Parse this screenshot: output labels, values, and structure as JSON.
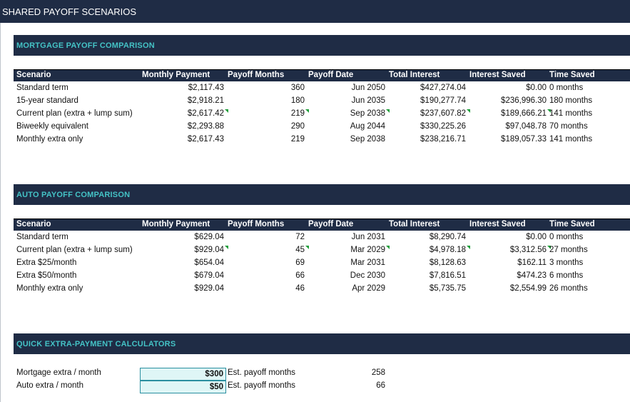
{
  "sheet_title": "SHARED PAYOFF SCENARIOS",
  "columns": [
    "Scenario",
    "Monthly Payment",
    "Payoff Months",
    "Payoff Date",
    "Total Interest",
    "Interest Saved",
    "Time Saved"
  ],
  "mortgage": {
    "section_title": "MORTGAGE PAYOFF COMPARISON",
    "rows": [
      {
        "scenario": "Standard term",
        "payment": "$2,117.43",
        "months": "360",
        "date": "Jun 2050",
        "interest": "$427,274.04",
        "saved": "$0.00",
        "time": "0 months"
      },
      {
        "scenario": "15-year standard",
        "payment": "$2,918.21",
        "months": "180",
        "date": "Jun 2035",
        "interest": "$190,277.74",
        "saved": "$236,996.30",
        "time": "180 months"
      },
      {
        "scenario": "Current plan (extra + lump sum)",
        "payment": "$2,617.42",
        "months": "219",
        "date": "Sep 2038",
        "interest": "$237,607.82",
        "saved": "$189,666.21",
        "time": "141 months"
      },
      {
        "scenario": "Biweekly equivalent",
        "payment": "$2,293.88",
        "months": "290",
        "date": "Aug 2044",
        "interest": "$330,225.26",
        "saved": "$97,048.78",
        "time": "70 months"
      },
      {
        "scenario": "Monthly extra only",
        "payment": "$2,617.43",
        "months": "219",
        "date": "Sep 2038",
        "interest": "$238,216.71",
        "saved": "$189,057.33",
        "time": "141 months"
      }
    ]
  },
  "auto": {
    "section_title": "AUTO PAYOFF COMPARISON",
    "rows": [
      {
        "scenario": "Standard term",
        "payment": "$629.04",
        "months": "72",
        "date": "Jun 2031",
        "interest": "$8,290.74",
        "saved": "$0.00",
        "time": "0 months"
      },
      {
        "scenario": "Current plan (extra + lump sum)",
        "payment": "$929.04",
        "months": "45",
        "date": "Mar 2029",
        "interest": "$4,978.18",
        "saved": "$3,312.56",
        "time": "27 months"
      },
      {
        "scenario": "Extra $25/month",
        "payment": "$654.04",
        "months": "69",
        "date": "Mar 2031",
        "interest": "$8,128.63",
        "saved": "$162.11",
        "time": "3 months"
      },
      {
        "scenario": "Extra $50/month",
        "payment": "$679.04",
        "months": "66",
        "date": "Dec 2030",
        "interest": "$7,816.51",
        "saved": "$474.23",
        "time": "6 months"
      },
      {
        "scenario": "Monthly extra only",
        "payment": "$929.04",
        "months": "46",
        "date": "Apr 2029",
        "interest": "$5,735.75",
        "saved": "$2,554.99",
        "time": "26 months"
      }
    ]
  },
  "calculators": {
    "section_title": "QUICK EXTRA-PAYMENT CALCULATORS",
    "rows": [
      {
        "label": "Mortgage extra / month",
        "input": "$300",
        "est_label": "Est. payoff months",
        "est_value": "258"
      },
      {
        "label": "Auto extra / month",
        "input": "$50",
        "est_label": "Est. payoff months",
        "est_value": "66"
      }
    ]
  },
  "colors": {
    "header_bg": "#1f2c45",
    "section_text": "#44c3c6",
    "input_bg": "#dff6f6",
    "comment_flag": "#1e9e3a"
  }
}
